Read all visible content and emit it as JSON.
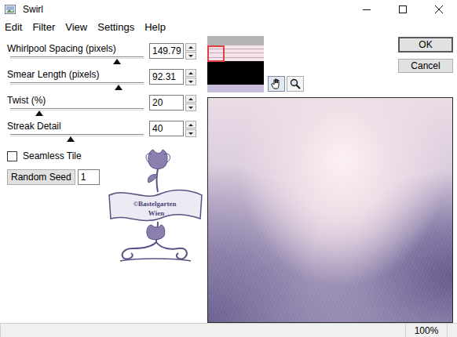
{
  "window": {
    "title": "Swirl"
  },
  "menu": [
    "Edit",
    "Filter",
    "View",
    "Settings",
    "Help"
  ],
  "sliders": [
    {
      "label": "Whirlpool Spacing (pixels)",
      "value": "149.79",
      "level": 0.8,
      "focused": true
    },
    {
      "label": "Smear Length (pixels)",
      "value": "92.31",
      "level": 0.81,
      "focused": false
    },
    {
      "label": "Twist (%)",
      "value": "20",
      "level": 0.22,
      "focused": false
    },
    {
      "label": "Streak Detail",
      "value": "40",
      "level": 0.45,
      "focused": false
    }
  ],
  "seamless_tile": {
    "label": "Seamless Tile",
    "checked": false
  },
  "random_seed": {
    "label": "Random Seed",
    "value": "1"
  },
  "logo": {
    "lines": [
      "©Bastelgarten",
      "Wien"
    ]
  },
  "buttons": [
    {
      "label": "OK",
      "default": true
    },
    {
      "label": "Cancel",
      "default": false
    }
  ],
  "status_bar": {
    "zoom": "100%"
  }
}
